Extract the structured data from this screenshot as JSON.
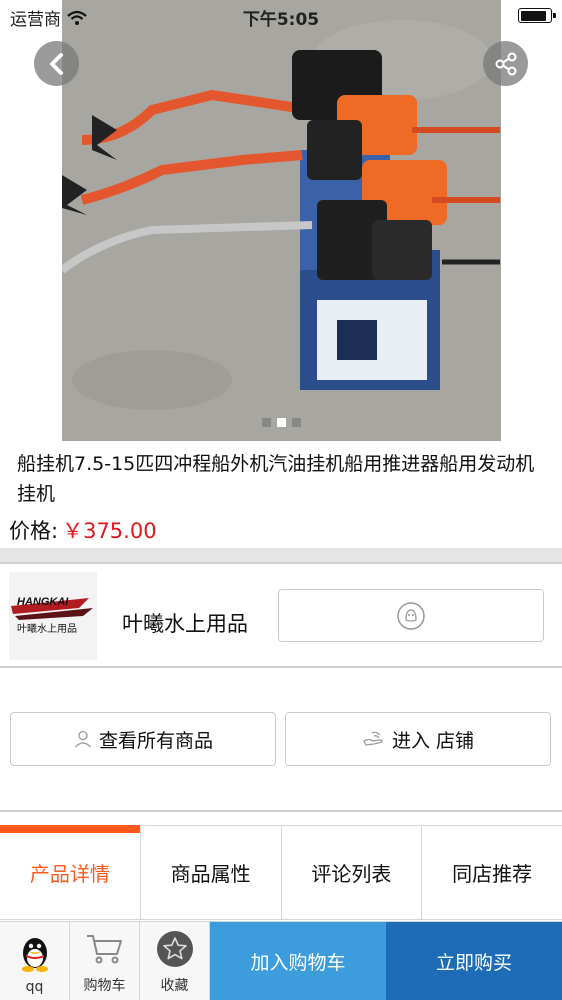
{
  "status_bar": {
    "carrier": "运营商",
    "time": "下午5:05",
    "battery_level": 0.9
  },
  "gallery": {
    "image_alt": "product-photo",
    "slide_count": 3,
    "active_slide": 2
  },
  "product": {
    "title": "船挂机7.5-15匹四冲程船外机汽油挂机船用推进器船用发动机挂机",
    "price_label": "价格:",
    "price_value": "￥375.00"
  },
  "shop": {
    "logo_text_top": "HANGKAI",
    "logo_text_bottom": "叶曦水上用品",
    "name": "叶曦水上用品",
    "contact_icon": "qq-bubble-icon"
  },
  "actions": {
    "view_all_label": "查看所有商品",
    "enter_shop_label": "进入 店铺"
  },
  "tabs": [
    {
      "label": "产品详情",
      "active": true
    },
    {
      "label": "商品属性",
      "active": false
    },
    {
      "label": "评论列表",
      "active": false
    },
    {
      "label": "同店推荐",
      "active": false
    }
  ],
  "bottom_bar": {
    "qq_label": "qq",
    "cart_label": "购物车",
    "favorite_label": "收藏",
    "add_to_cart_label": "加入购物车",
    "buy_now_label": "立即购买"
  },
  "colors": {
    "accent": "#ff5a1e",
    "price": "#e4161b",
    "cart_button": "#3d9cdc",
    "buy_button": "#1e6cb8"
  }
}
